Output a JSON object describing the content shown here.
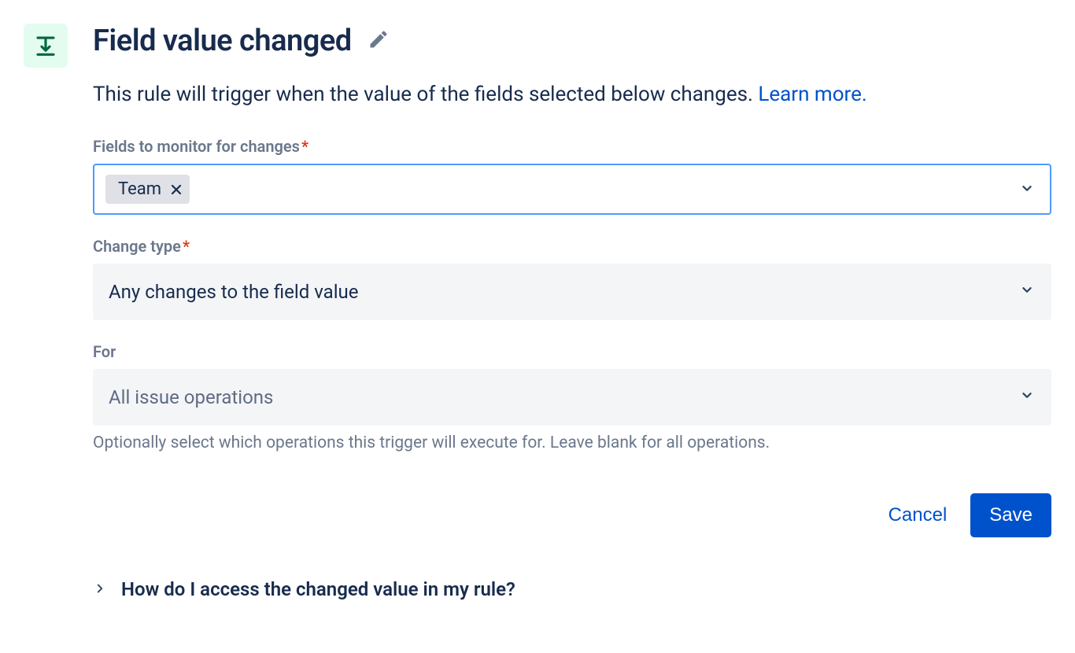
{
  "header": {
    "title": "Field value changed"
  },
  "description": {
    "text": "This rule will trigger when the value of the fields selected below changes. ",
    "learn_more": "Learn more."
  },
  "fields_monitor": {
    "label": "Fields to monitor for changes",
    "tags": [
      {
        "label": "Team"
      }
    ]
  },
  "change_type": {
    "label": "Change type",
    "value": "Any changes to the field value"
  },
  "for": {
    "label": "For",
    "placeholder": "All issue operations",
    "help": "Optionally select which operations this trigger will execute for. Leave blank for all operations."
  },
  "footer": {
    "cancel": "Cancel",
    "save": "Save"
  },
  "expander": {
    "label": "How do I access the changed value in my rule?"
  }
}
